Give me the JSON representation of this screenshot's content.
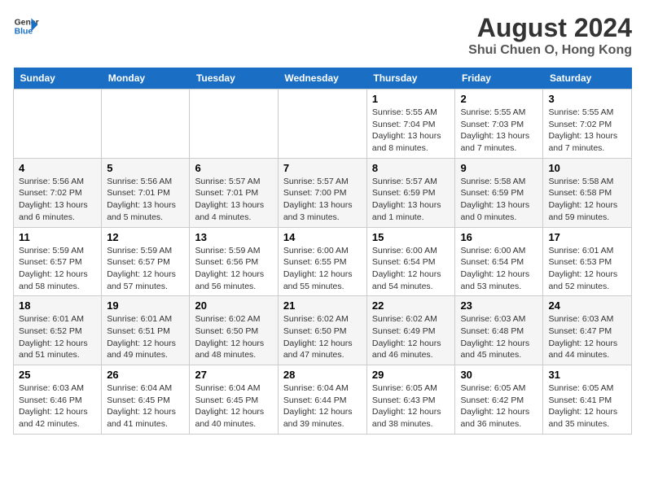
{
  "logo": {
    "line1": "General",
    "line2": "Blue"
  },
  "title": "August 2024",
  "subtitle": "Shui Chuen O, Hong Kong",
  "headers": [
    "Sunday",
    "Monday",
    "Tuesday",
    "Wednesday",
    "Thursday",
    "Friday",
    "Saturday"
  ],
  "weeks": [
    [
      {
        "day": "",
        "info": ""
      },
      {
        "day": "",
        "info": ""
      },
      {
        "day": "",
        "info": ""
      },
      {
        "day": "",
        "info": ""
      },
      {
        "day": "1",
        "info": "Sunrise: 5:55 AM\nSunset: 7:04 PM\nDaylight: 13 hours\nand 8 minutes."
      },
      {
        "day": "2",
        "info": "Sunrise: 5:55 AM\nSunset: 7:03 PM\nDaylight: 13 hours\nand 7 minutes."
      },
      {
        "day": "3",
        "info": "Sunrise: 5:55 AM\nSunset: 7:02 PM\nDaylight: 13 hours\nand 7 minutes."
      }
    ],
    [
      {
        "day": "4",
        "info": "Sunrise: 5:56 AM\nSunset: 7:02 PM\nDaylight: 13 hours\nand 6 minutes."
      },
      {
        "day": "5",
        "info": "Sunrise: 5:56 AM\nSunset: 7:01 PM\nDaylight: 13 hours\nand 5 minutes."
      },
      {
        "day": "6",
        "info": "Sunrise: 5:57 AM\nSunset: 7:01 PM\nDaylight: 13 hours\nand 4 minutes."
      },
      {
        "day": "7",
        "info": "Sunrise: 5:57 AM\nSunset: 7:00 PM\nDaylight: 13 hours\nand 3 minutes."
      },
      {
        "day": "8",
        "info": "Sunrise: 5:57 AM\nSunset: 6:59 PM\nDaylight: 13 hours\nand 1 minute."
      },
      {
        "day": "9",
        "info": "Sunrise: 5:58 AM\nSunset: 6:59 PM\nDaylight: 13 hours\nand 0 minutes."
      },
      {
        "day": "10",
        "info": "Sunrise: 5:58 AM\nSunset: 6:58 PM\nDaylight: 12 hours\nand 59 minutes."
      }
    ],
    [
      {
        "day": "11",
        "info": "Sunrise: 5:59 AM\nSunset: 6:57 PM\nDaylight: 12 hours\nand 58 minutes."
      },
      {
        "day": "12",
        "info": "Sunrise: 5:59 AM\nSunset: 6:57 PM\nDaylight: 12 hours\nand 57 minutes."
      },
      {
        "day": "13",
        "info": "Sunrise: 5:59 AM\nSunset: 6:56 PM\nDaylight: 12 hours\nand 56 minutes."
      },
      {
        "day": "14",
        "info": "Sunrise: 6:00 AM\nSunset: 6:55 PM\nDaylight: 12 hours\nand 55 minutes."
      },
      {
        "day": "15",
        "info": "Sunrise: 6:00 AM\nSunset: 6:54 PM\nDaylight: 12 hours\nand 54 minutes."
      },
      {
        "day": "16",
        "info": "Sunrise: 6:00 AM\nSunset: 6:54 PM\nDaylight: 12 hours\nand 53 minutes."
      },
      {
        "day": "17",
        "info": "Sunrise: 6:01 AM\nSunset: 6:53 PM\nDaylight: 12 hours\nand 52 minutes."
      }
    ],
    [
      {
        "day": "18",
        "info": "Sunrise: 6:01 AM\nSunset: 6:52 PM\nDaylight: 12 hours\nand 51 minutes."
      },
      {
        "day": "19",
        "info": "Sunrise: 6:01 AM\nSunset: 6:51 PM\nDaylight: 12 hours\nand 49 minutes."
      },
      {
        "day": "20",
        "info": "Sunrise: 6:02 AM\nSunset: 6:50 PM\nDaylight: 12 hours\nand 48 minutes."
      },
      {
        "day": "21",
        "info": "Sunrise: 6:02 AM\nSunset: 6:50 PM\nDaylight: 12 hours\nand 47 minutes."
      },
      {
        "day": "22",
        "info": "Sunrise: 6:02 AM\nSunset: 6:49 PM\nDaylight: 12 hours\nand 46 minutes."
      },
      {
        "day": "23",
        "info": "Sunrise: 6:03 AM\nSunset: 6:48 PM\nDaylight: 12 hours\nand 45 minutes."
      },
      {
        "day": "24",
        "info": "Sunrise: 6:03 AM\nSunset: 6:47 PM\nDaylight: 12 hours\nand 44 minutes."
      }
    ],
    [
      {
        "day": "25",
        "info": "Sunrise: 6:03 AM\nSunset: 6:46 PM\nDaylight: 12 hours\nand 42 minutes."
      },
      {
        "day": "26",
        "info": "Sunrise: 6:04 AM\nSunset: 6:45 PM\nDaylight: 12 hours\nand 41 minutes."
      },
      {
        "day": "27",
        "info": "Sunrise: 6:04 AM\nSunset: 6:45 PM\nDaylight: 12 hours\nand 40 minutes."
      },
      {
        "day": "28",
        "info": "Sunrise: 6:04 AM\nSunset: 6:44 PM\nDaylight: 12 hours\nand 39 minutes."
      },
      {
        "day": "29",
        "info": "Sunrise: 6:05 AM\nSunset: 6:43 PM\nDaylight: 12 hours\nand 38 minutes."
      },
      {
        "day": "30",
        "info": "Sunrise: 6:05 AM\nSunset: 6:42 PM\nDaylight: 12 hours\nand 36 minutes."
      },
      {
        "day": "31",
        "info": "Sunrise: 6:05 AM\nSunset: 6:41 PM\nDaylight: 12 hours\nand 35 minutes."
      }
    ]
  ]
}
